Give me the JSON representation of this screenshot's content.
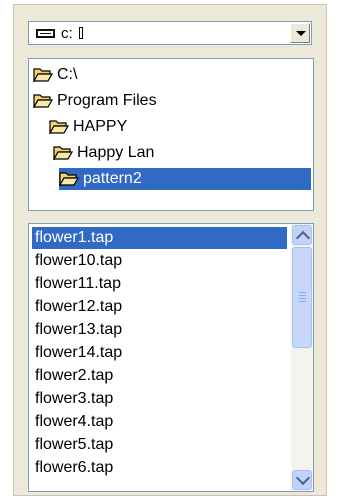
{
  "drive": {
    "label": "c:",
    "icon": "drive-icon"
  },
  "directories": [
    {
      "label": "C:\\",
      "icon": "folder-open-icon",
      "selected": false
    },
    {
      "label": "Program Files",
      "icon": "folder-open-icon",
      "selected": false
    },
    {
      "label": "HAPPY",
      "icon": "folder-open-icon",
      "selected": false
    },
    {
      "label": "Happy Lan",
      "icon": "folder-open-icon",
      "selected": false
    },
    {
      "label": "pattern2",
      "icon": "folder-open-icon",
      "selected": true
    }
  ],
  "files": [
    {
      "name": "flower1.tap",
      "selected": true
    },
    {
      "name": "flower10.tap",
      "selected": false
    },
    {
      "name": "flower11.tap",
      "selected": false
    },
    {
      "name": "flower12.tap",
      "selected": false
    },
    {
      "name": "flower13.tap",
      "selected": false
    },
    {
      "name": "flower14.tap",
      "selected": false
    },
    {
      "name": "flower2.tap",
      "selected": false
    },
    {
      "name": "flower3.tap",
      "selected": false
    },
    {
      "name": "flower4.tap",
      "selected": false
    },
    {
      "name": "flower5.tap",
      "selected": false
    },
    {
      "name": "flower6.tap",
      "selected": false
    }
  ],
  "colors": {
    "selection": "#316ac5",
    "panel": "#ece9d8",
    "folder": "#f5d36a"
  }
}
